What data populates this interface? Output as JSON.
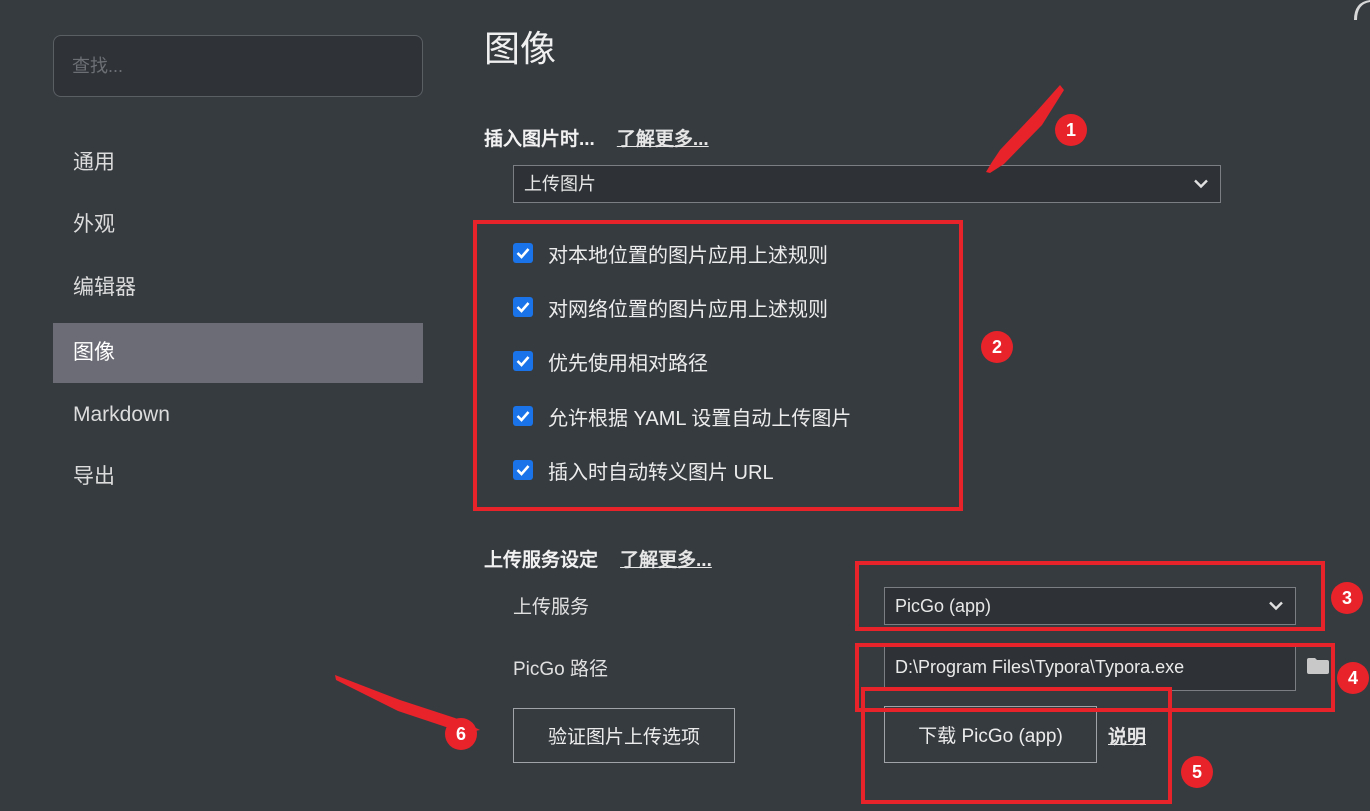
{
  "sidebar": {
    "search_placeholder": "查找...",
    "items": [
      {
        "label": "通用"
      },
      {
        "label": "外观"
      },
      {
        "label": "编辑器"
      },
      {
        "label": "图像",
        "active": true
      },
      {
        "label": "Markdown"
      },
      {
        "label": "导出"
      }
    ]
  },
  "main": {
    "title": "图像",
    "insert": {
      "heading": "插入图片时...",
      "learn_more": "了解更多...",
      "selected": "上传图片",
      "checks": [
        {
          "label": "对本地位置的图片应用上述规则",
          "checked": true
        },
        {
          "label": "对网络位置的图片应用上述规则",
          "checked": true
        },
        {
          "label": "优先使用相对路径",
          "checked": true
        },
        {
          "label": "允许根据 YAML 设置自动上传图片",
          "checked": true
        },
        {
          "label": "插入时自动转义图片 URL",
          "checked": true
        }
      ]
    },
    "upload": {
      "heading": "上传服务设定",
      "learn_more": "了解更多...",
      "service_label": "上传服务",
      "service_value": "PicGo (app)",
      "path_label": "PicGo 路径",
      "path_value": "D:\\Program Files\\Typora\\Typora.exe",
      "verify_button": "验证图片上传选项",
      "download_button": "下载 PicGo (app)",
      "doc_link": "说明"
    }
  },
  "annotations": {
    "color": "#e8232a",
    "badges": [
      "1",
      "2",
      "3",
      "4",
      "5",
      "6"
    ]
  },
  "colors": {
    "background": "#363b40",
    "active_nav": "#6c6c76",
    "checkbox": "#1a73e8"
  }
}
